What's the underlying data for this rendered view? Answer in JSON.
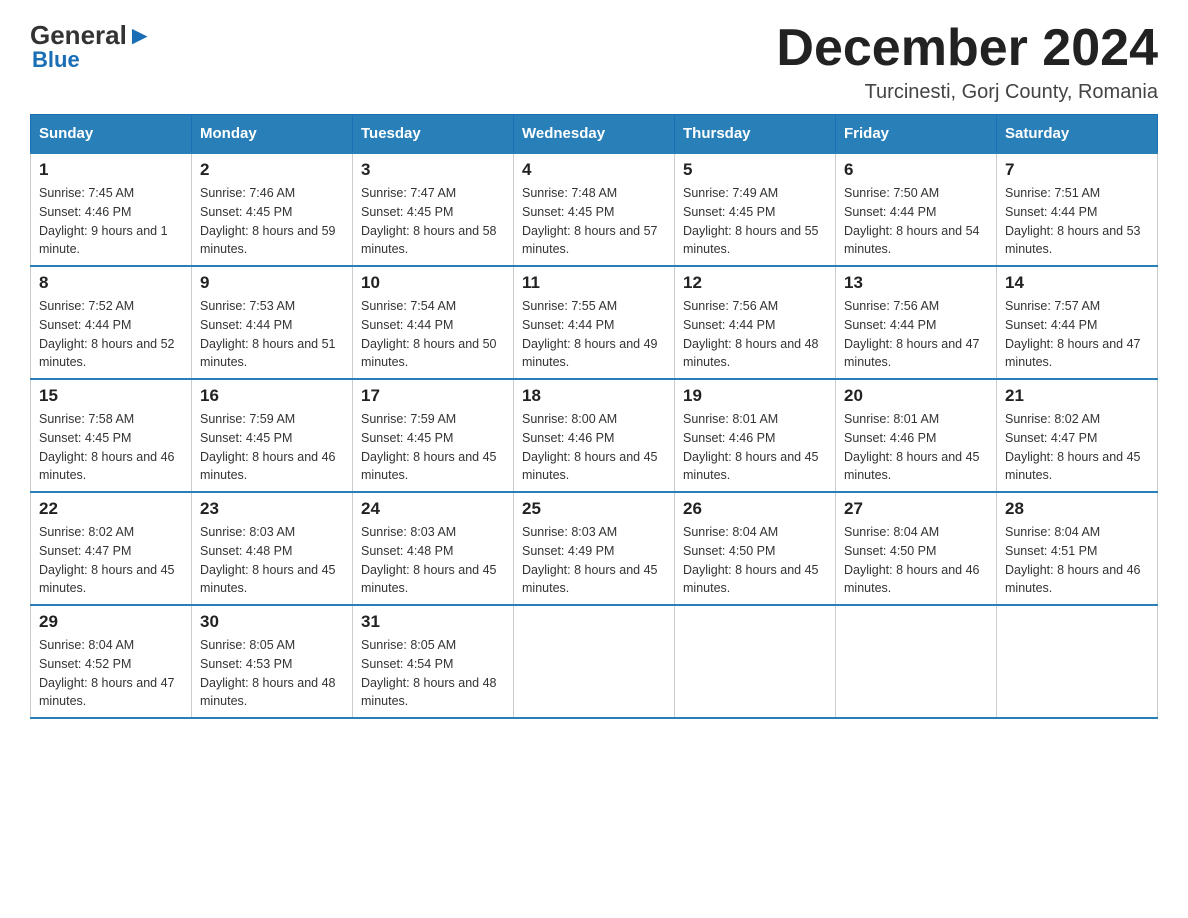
{
  "header": {
    "logo": {
      "general": "General",
      "blue": "Blue"
    },
    "title": "December 2024",
    "subtitle": "Turcinesti, Gorj County, Romania"
  },
  "weekdays": [
    "Sunday",
    "Monday",
    "Tuesday",
    "Wednesday",
    "Thursday",
    "Friday",
    "Saturday"
  ],
  "weeks": [
    [
      {
        "day": "1",
        "sunrise": "7:45 AM",
        "sunset": "4:46 PM",
        "daylight": "9 hours and 1 minute."
      },
      {
        "day": "2",
        "sunrise": "7:46 AM",
        "sunset": "4:45 PM",
        "daylight": "8 hours and 59 minutes."
      },
      {
        "day": "3",
        "sunrise": "7:47 AM",
        "sunset": "4:45 PM",
        "daylight": "8 hours and 58 minutes."
      },
      {
        "day": "4",
        "sunrise": "7:48 AM",
        "sunset": "4:45 PM",
        "daylight": "8 hours and 57 minutes."
      },
      {
        "day": "5",
        "sunrise": "7:49 AM",
        "sunset": "4:45 PM",
        "daylight": "8 hours and 55 minutes."
      },
      {
        "day": "6",
        "sunrise": "7:50 AM",
        "sunset": "4:44 PM",
        "daylight": "8 hours and 54 minutes."
      },
      {
        "day": "7",
        "sunrise": "7:51 AM",
        "sunset": "4:44 PM",
        "daylight": "8 hours and 53 minutes."
      }
    ],
    [
      {
        "day": "8",
        "sunrise": "7:52 AM",
        "sunset": "4:44 PM",
        "daylight": "8 hours and 52 minutes."
      },
      {
        "day": "9",
        "sunrise": "7:53 AM",
        "sunset": "4:44 PM",
        "daylight": "8 hours and 51 minutes."
      },
      {
        "day": "10",
        "sunrise": "7:54 AM",
        "sunset": "4:44 PM",
        "daylight": "8 hours and 50 minutes."
      },
      {
        "day": "11",
        "sunrise": "7:55 AM",
        "sunset": "4:44 PM",
        "daylight": "8 hours and 49 minutes."
      },
      {
        "day": "12",
        "sunrise": "7:56 AM",
        "sunset": "4:44 PM",
        "daylight": "8 hours and 48 minutes."
      },
      {
        "day": "13",
        "sunrise": "7:56 AM",
        "sunset": "4:44 PM",
        "daylight": "8 hours and 47 minutes."
      },
      {
        "day": "14",
        "sunrise": "7:57 AM",
        "sunset": "4:44 PM",
        "daylight": "8 hours and 47 minutes."
      }
    ],
    [
      {
        "day": "15",
        "sunrise": "7:58 AM",
        "sunset": "4:45 PM",
        "daylight": "8 hours and 46 minutes."
      },
      {
        "day": "16",
        "sunrise": "7:59 AM",
        "sunset": "4:45 PM",
        "daylight": "8 hours and 46 minutes."
      },
      {
        "day": "17",
        "sunrise": "7:59 AM",
        "sunset": "4:45 PM",
        "daylight": "8 hours and 45 minutes."
      },
      {
        "day": "18",
        "sunrise": "8:00 AM",
        "sunset": "4:46 PM",
        "daylight": "8 hours and 45 minutes."
      },
      {
        "day": "19",
        "sunrise": "8:01 AM",
        "sunset": "4:46 PM",
        "daylight": "8 hours and 45 minutes."
      },
      {
        "day": "20",
        "sunrise": "8:01 AM",
        "sunset": "4:46 PM",
        "daylight": "8 hours and 45 minutes."
      },
      {
        "day": "21",
        "sunrise": "8:02 AM",
        "sunset": "4:47 PM",
        "daylight": "8 hours and 45 minutes."
      }
    ],
    [
      {
        "day": "22",
        "sunrise": "8:02 AM",
        "sunset": "4:47 PM",
        "daylight": "8 hours and 45 minutes."
      },
      {
        "day": "23",
        "sunrise": "8:03 AM",
        "sunset": "4:48 PM",
        "daylight": "8 hours and 45 minutes."
      },
      {
        "day": "24",
        "sunrise": "8:03 AM",
        "sunset": "4:48 PM",
        "daylight": "8 hours and 45 minutes."
      },
      {
        "day": "25",
        "sunrise": "8:03 AM",
        "sunset": "4:49 PM",
        "daylight": "8 hours and 45 minutes."
      },
      {
        "day": "26",
        "sunrise": "8:04 AM",
        "sunset": "4:50 PM",
        "daylight": "8 hours and 45 minutes."
      },
      {
        "day": "27",
        "sunrise": "8:04 AM",
        "sunset": "4:50 PM",
        "daylight": "8 hours and 46 minutes."
      },
      {
        "day": "28",
        "sunrise": "8:04 AM",
        "sunset": "4:51 PM",
        "daylight": "8 hours and 46 minutes."
      }
    ],
    [
      {
        "day": "29",
        "sunrise": "8:04 AM",
        "sunset": "4:52 PM",
        "daylight": "8 hours and 47 minutes."
      },
      {
        "day": "30",
        "sunrise": "8:05 AM",
        "sunset": "4:53 PM",
        "daylight": "8 hours and 48 minutes."
      },
      {
        "day": "31",
        "sunrise": "8:05 AM",
        "sunset": "4:54 PM",
        "daylight": "8 hours and 48 minutes."
      },
      null,
      null,
      null,
      null
    ]
  ]
}
